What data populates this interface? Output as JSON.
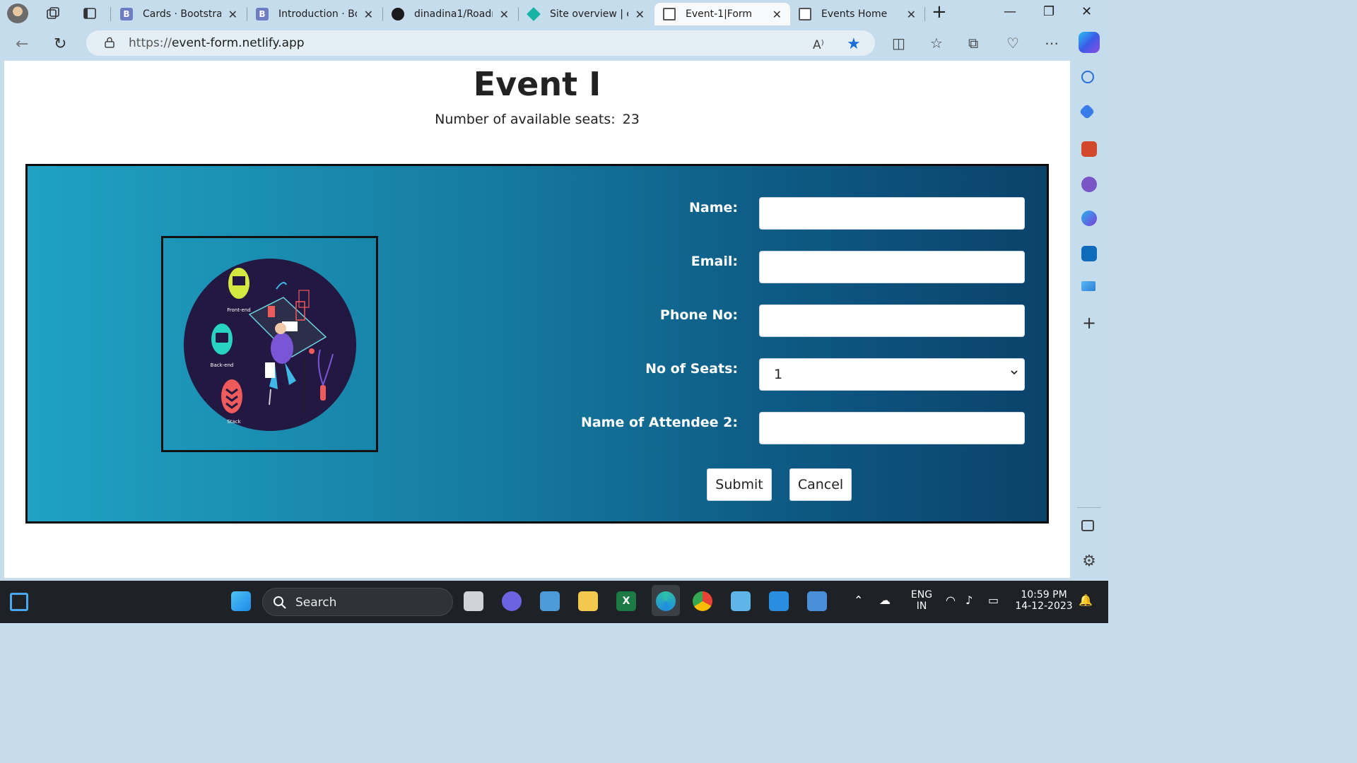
{
  "browser": {
    "tabs": [
      {
        "title": "Cards · Bootstrap",
        "icon": "bootstrap-icon",
        "active": false
      },
      {
        "title": "Introduction · Bo",
        "icon": "bootstrap-icon",
        "active": false
      },
      {
        "title": "dinadina1/Roadn",
        "icon": "github-icon",
        "active": false
      },
      {
        "title": "Site overview | ev",
        "icon": "netlify-icon",
        "active": false
      },
      {
        "title": "Event-1|Form",
        "icon": "page-icon",
        "active": true
      },
      {
        "title": "Events Home",
        "icon": "page-icon",
        "active": false
      }
    ],
    "url_scheme": "https://",
    "url_host": "event-form.netlify.app"
  },
  "page": {
    "title": "Event I",
    "seats_label": "Number of available seats:",
    "seats_count": "23"
  },
  "form": {
    "fields": [
      {
        "label": "Name:",
        "value": ""
      },
      {
        "label": "Email:",
        "value": ""
      },
      {
        "label": "Phone No:",
        "value": ""
      },
      {
        "label": "No of Seats:",
        "value": "1"
      },
      {
        "label": "Name of Attendee 2:",
        "value": ""
      }
    ],
    "submit_label": "Submit",
    "cancel_label": "Cancel",
    "illustration": {
      "label_frontend": "Front-end",
      "label_backend": "Back-end",
      "label_stack": "Stack"
    }
  },
  "taskbar": {
    "search_placeholder": "Search",
    "lang_line1": "ENG",
    "lang_line2": "IN",
    "time": "10:59 PM",
    "date": "14-12-2023"
  },
  "colors": {
    "panel_gradient_start": "#1fa2c4",
    "panel_gradient_end": "#0b426a",
    "tab_bar": "#c5dcec",
    "star": "#1a6fd6"
  }
}
